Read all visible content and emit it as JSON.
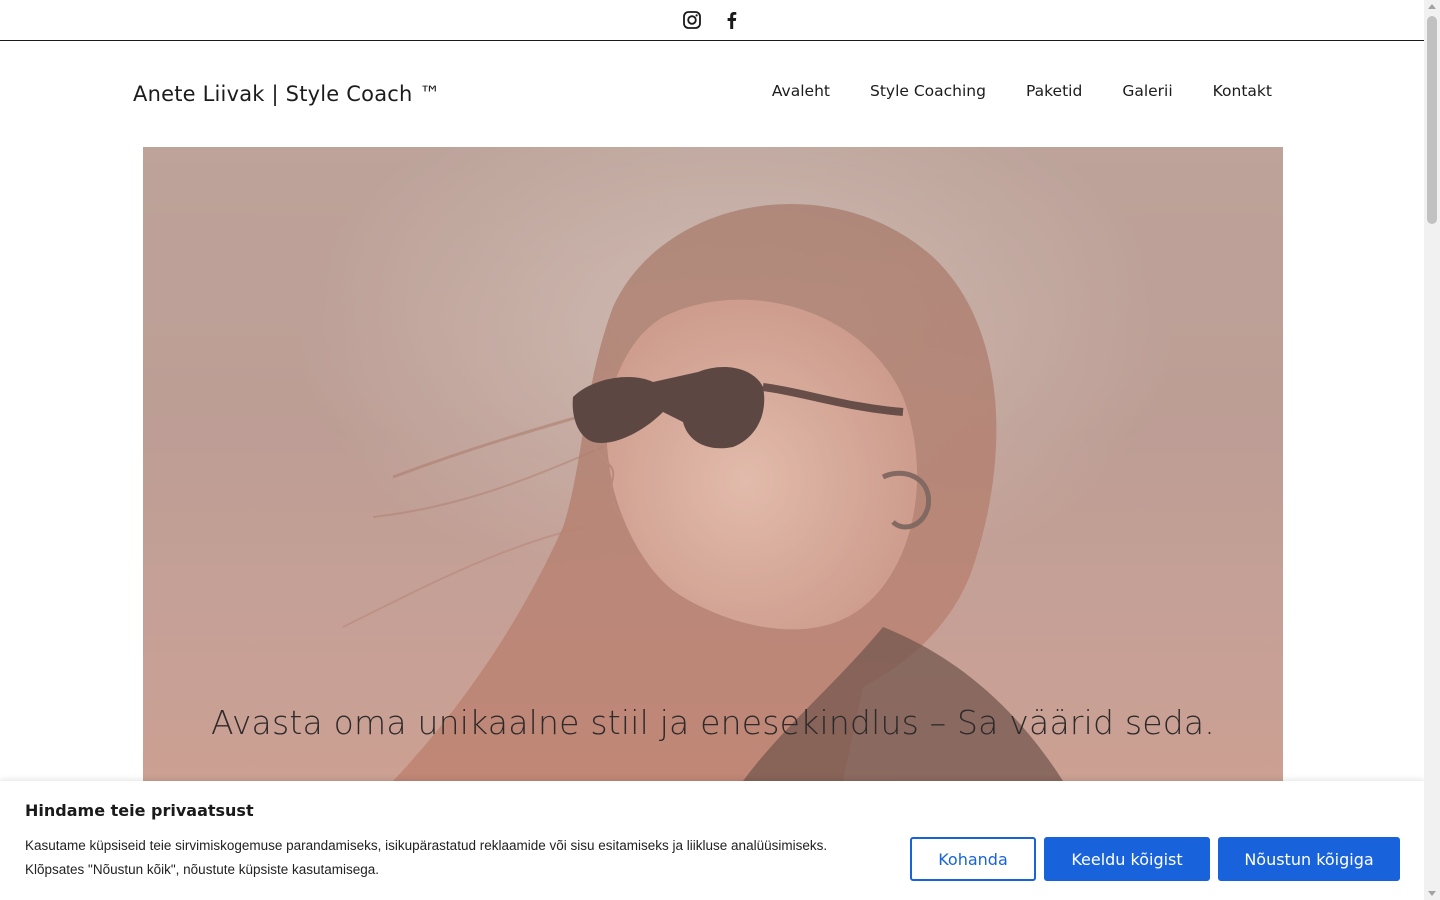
{
  "social": {
    "instagram_icon": "instagram-icon",
    "facebook_icon": "facebook-icon"
  },
  "header": {
    "brand": "Anete Liivak | Style Coach ™",
    "nav": [
      {
        "label": "Avaleht"
      },
      {
        "label": "Style Coaching"
      },
      {
        "label": "Paketid"
      },
      {
        "label": "Galerii"
      },
      {
        "label": "Kontakt"
      }
    ]
  },
  "hero": {
    "caption": "Avasta oma unikaalne stiil ja enesekindlus – Sa väärid seda."
  },
  "cookie": {
    "title": "Hindame teie privaatsust",
    "text": "Kasutame küpsiseid teie sirvimiskogemuse parandamiseks, isikupärastatud reklaamide või sisu esitamiseks ja liikluse analüüsimiseks. Klõpsates \"Nõustun kõik\", nõustute küpsiste kasutamisega.",
    "customize_label": "Kohanda",
    "reject_label": "Keeldu kõigist",
    "accept_label": "Nõustun kõigiga"
  },
  "colors": {
    "accent": "#1863dc",
    "hero_tint": "#b69389"
  }
}
